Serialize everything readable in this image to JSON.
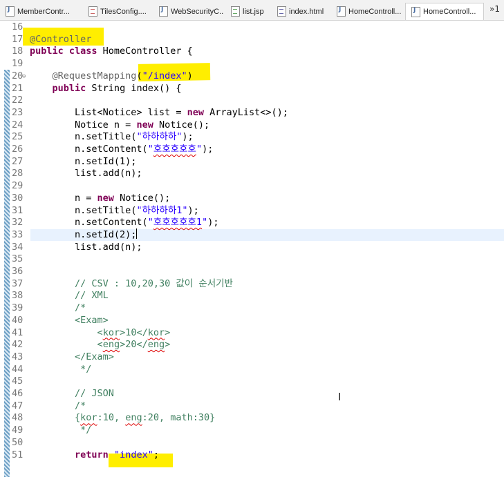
{
  "tabs": [
    {
      "label": "MemberContr...",
      "type": "java"
    },
    {
      "label": "TilesConfig....",
      "type": "xml"
    },
    {
      "label": "WebSecurityC...",
      "type": "java"
    },
    {
      "label": "list.jsp",
      "type": "jsp"
    },
    {
      "label": "index.html",
      "type": "html"
    },
    {
      "label": "HomeControll...",
      "type": "java"
    },
    {
      "label": "HomeControll...",
      "type": "java",
      "active": true
    }
  ],
  "overflow_label": "»1",
  "editor": {
    "highlight_color": "#ffee00",
    "lines": [
      {
        "num": "16",
        "tokens": []
      },
      {
        "num": "17",
        "tokens": [
          {
            "t": "@Controller",
            "c": "ann"
          }
        ]
      },
      {
        "num": "18",
        "tokens": [
          {
            "t": "public class",
            "c": "kw"
          },
          {
            "t": " HomeController {",
            "c": ""
          }
        ]
      },
      {
        "num": "19",
        "tokens": []
      },
      {
        "num": "20",
        "fold": true,
        "tokens": [
          {
            "t": "    ",
            "c": ""
          },
          {
            "t": "@RequestMapping",
            "c": "ann"
          },
          {
            "t": "(",
            "c": ""
          },
          {
            "t": "\"/index\"",
            "c": "str"
          },
          {
            "t": ")",
            "c": ""
          }
        ]
      },
      {
        "num": "21",
        "tokens": [
          {
            "t": "    ",
            "c": ""
          },
          {
            "t": "public",
            "c": "kw"
          },
          {
            "t": " String index() {",
            "c": ""
          }
        ]
      },
      {
        "num": "22",
        "tokens": []
      },
      {
        "num": "23",
        "tokens": [
          {
            "t": "        List<Notice> list = ",
            "c": ""
          },
          {
            "t": "new",
            "c": "kw"
          },
          {
            "t": " ArrayList<>();",
            "c": ""
          }
        ]
      },
      {
        "num": "24",
        "tokens": [
          {
            "t": "        Notice n = ",
            "c": ""
          },
          {
            "t": "new",
            "c": "kw"
          },
          {
            "t": " Notice();",
            "c": ""
          }
        ]
      },
      {
        "num": "25",
        "tokens": [
          {
            "t": "        n.setTitle(",
            "c": ""
          },
          {
            "t": "\"하하하하\"",
            "c": "str"
          },
          {
            "t": ");",
            "c": ""
          }
        ]
      },
      {
        "num": "26",
        "tokens": [
          {
            "t": "        n.setContent(",
            "c": ""
          },
          {
            "t": "\"",
            "c": "str"
          },
          {
            "t": "호호호호호",
            "c": "str ul"
          },
          {
            "t": "\"",
            "c": "str"
          },
          {
            "t": ");",
            "c": ""
          }
        ]
      },
      {
        "num": "27",
        "tokens": [
          {
            "t": "        n.setId(1);",
            "c": ""
          }
        ]
      },
      {
        "num": "28",
        "tokens": [
          {
            "t": "        list.add(n);",
            "c": ""
          }
        ]
      },
      {
        "num": "29",
        "tokens": []
      },
      {
        "num": "30",
        "tokens": [
          {
            "t": "        n = ",
            "c": ""
          },
          {
            "t": "new",
            "c": "kw"
          },
          {
            "t": " Notice();",
            "c": ""
          }
        ]
      },
      {
        "num": "31",
        "tokens": [
          {
            "t": "        n.setTitle(",
            "c": ""
          },
          {
            "t": "\"하하하하1\"",
            "c": "str"
          },
          {
            "t": ");",
            "c": ""
          }
        ]
      },
      {
        "num": "32",
        "tokens": [
          {
            "t": "        n.setContent(",
            "c": ""
          },
          {
            "t": "\"",
            "c": "str"
          },
          {
            "t": "호호호호호1",
            "c": "str ul"
          },
          {
            "t": "\"",
            "c": "str"
          },
          {
            "t": ");",
            "c": ""
          }
        ]
      },
      {
        "num": "33",
        "current": true,
        "tokens": [
          {
            "t": "        n.setId(2);",
            "c": ""
          }
        ]
      },
      {
        "num": "34",
        "tokens": [
          {
            "t": "        list.add(n);",
            "c": ""
          }
        ]
      },
      {
        "num": "35",
        "tokens": []
      },
      {
        "num": "36",
        "tokens": []
      },
      {
        "num": "37",
        "tokens": [
          {
            "t": "        ",
            "c": ""
          },
          {
            "t": "// CSV : 10,20,30 값이 순서기반",
            "c": "cm"
          }
        ]
      },
      {
        "num": "38",
        "tokens": [
          {
            "t": "        ",
            "c": ""
          },
          {
            "t": "// XML",
            "c": "cm"
          }
        ]
      },
      {
        "num": "39",
        "tokens": [
          {
            "t": "        ",
            "c": ""
          },
          {
            "t": "/*",
            "c": "cm"
          }
        ]
      },
      {
        "num": "40",
        "tokens": [
          {
            "t": "        ",
            "c": ""
          },
          {
            "t": "<Exam>",
            "c": "cm"
          }
        ]
      },
      {
        "num": "41",
        "tokens": [
          {
            "t": "            ",
            "c": ""
          },
          {
            "t": "<",
            "c": "cm"
          },
          {
            "t": "kor",
            "c": "cm ul"
          },
          {
            "t": ">10</",
            "c": "cm"
          },
          {
            "t": "kor",
            "c": "cm ul"
          },
          {
            "t": ">",
            "c": "cm"
          }
        ]
      },
      {
        "num": "42",
        "tokens": [
          {
            "t": "            ",
            "c": ""
          },
          {
            "t": "<",
            "c": "cm"
          },
          {
            "t": "eng",
            "c": "cm ul"
          },
          {
            "t": ">20</",
            "c": "cm"
          },
          {
            "t": "eng",
            "c": "cm ul"
          },
          {
            "t": ">",
            "c": "cm"
          }
        ]
      },
      {
        "num": "43",
        "tokens": [
          {
            "t": "        ",
            "c": ""
          },
          {
            "t": "</Exam>",
            "c": "cm"
          }
        ]
      },
      {
        "num": "44",
        "tokens": [
          {
            "t": "         ",
            "c": ""
          },
          {
            "t": "*/",
            "c": "cm"
          }
        ]
      },
      {
        "num": "45",
        "tokens": []
      },
      {
        "num": "46",
        "tokens": [
          {
            "t": "        ",
            "c": ""
          },
          {
            "t": "// JSON",
            "c": "cm"
          }
        ]
      },
      {
        "num": "47",
        "tokens": [
          {
            "t": "        ",
            "c": ""
          },
          {
            "t": "/*",
            "c": "cm"
          }
        ]
      },
      {
        "num": "48",
        "tokens": [
          {
            "t": "        ",
            "c": ""
          },
          {
            "t": "{",
            "c": "cm"
          },
          {
            "t": "kor",
            "c": "cm ul"
          },
          {
            "t": ":10, ",
            "c": "cm"
          },
          {
            "t": "eng",
            "c": "cm ul"
          },
          {
            "t": ":20, math:30}",
            "c": "cm"
          }
        ]
      },
      {
        "num": "49",
        "tokens": [
          {
            "t": "         ",
            "c": ""
          },
          {
            "t": "*/",
            "c": "cm"
          }
        ]
      },
      {
        "num": "50",
        "tokens": []
      },
      {
        "num": "51",
        "tokens": [
          {
            "t": "        ",
            "c": ""
          },
          {
            "t": "return",
            "c": "kw"
          },
          {
            "t": " ",
            "c": ""
          },
          {
            "t": "\"index\"",
            "c": "str"
          },
          {
            "t": ";",
            "c": ""
          }
        ]
      }
    ]
  }
}
